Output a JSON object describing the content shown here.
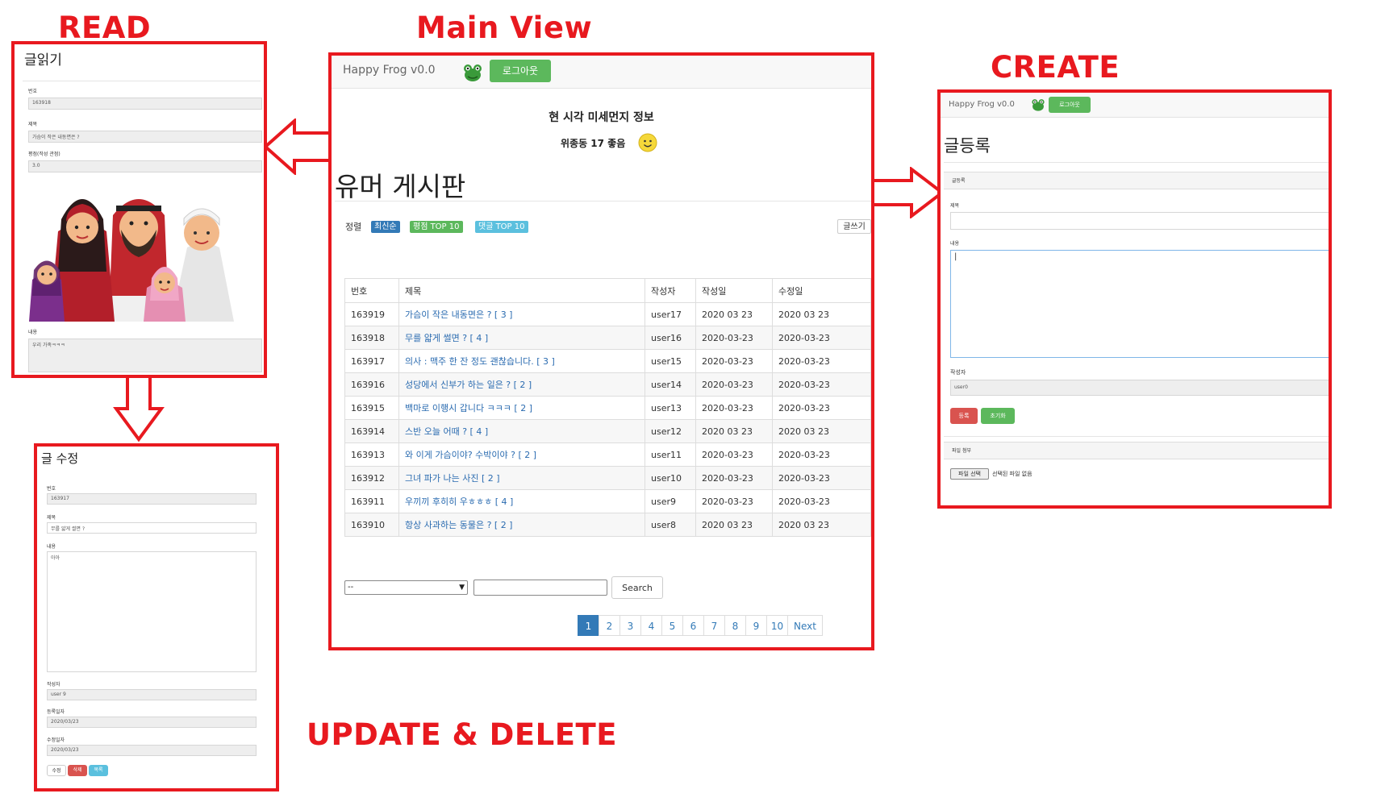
{
  "headings": {
    "read": "READ",
    "main": "Main View",
    "create": "CREATE",
    "update": "UPDATE & DELETE"
  },
  "main": {
    "brand": "Happy Frog v0.0",
    "logout": "로그아웃",
    "dust_title": "현 시각 미세먼지 정보",
    "dust_value": "위종동 17 좋음",
    "board_title": "유머 게시판",
    "sort_label": "정렬",
    "sort_latest": "최신순",
    "sort_rating": "평점 TOP 10",
    "sort_comment": "댓글 TOP 10",
    "write_button": "글쓰기",
    "columns": [
      "번호",
      "제목",
      "작성자",
      "작성일",
      "수정일"
    ],
    "rows": [
      [
        "163919",
        "가슴이 작은 내동면은 ? [ 3 ]",
        "user17",
        "2020 03 23",
        "2020 03 23"
      ],
      [
        "163918",
        "무를 얇게 썰면 ? [ 4 ]",
        "user16",
        "2020-03-23",
        "2020-03-23"
      ],
      [
        "163917",
        "의사 : 맥주 한 잔 정도 괜찮습니다. [ 3 ]",
        "user15",
        "2020-03-23",
        "2020-03-23"
      ],
      [
        "163916",
        "성당에서 신부가 하는 일은 ? [ 2 ]",
        "user14",
        "2020-03-23",
        "2020-03-23"
      ],
      [
        "163915",
        "백마로 이행시 갑니다 ㅋㅋㅋ [ 2 ]",
        "user13",
        "2020-03-23",
        "2020-03-23"
      ],
      [
        "163914",
        "스반 오늘 어때 ? [ 4 ]",
        "user12",
        "2020 03 23",
        "2020 03 23"
      ],
      [
        "163913",
        "와 이게 가슴이야? 수박이야 ? [ 2 ]",
        "user11",
        "2020-03-23",
        "2020-03-23"
      ],
      [
        "163912",
        "그녀 파가 나는 사진 [ 2 ]",
        "user10",
        "2020-03-23",
        "2020-03-23"
      ],
      [
        "163911",
        "우끼끼 후히히 우ㅎㅎㅎ [ 4 ]",
        "user9",
        "2020-03-23",
        "2020-03-23"
      ],
      [
        "163910",
        "항상 사과하는 동물은 ? [ 2 ]",
        "user8",
        "2020 03 23",
        "2020 03 23"
      ]
    ],
    "search_select": "--",
    "search_button": "Search",
    "pages": [
      "1",
      "2",
      "3",
      "4",
      "5",
      "6",
      "7",
      "8",
      "9",
      "10"
    ],
    "next": "Next"
  },
  "read": {
    "title": "글읽기",
    "label_no": "번호",
    "value_no": "163918",
    "label_title": "제목",
    "value_title": "가슴이 작은 내동면은 ?",
    "label_rating": "평점(작성 관점)",
    "value_rating": "3.0",
    "label_content": "내용",
    "value_content": "우리 가족ㅋㅋㅋ"
  },
  "update": {
    "title": "글 수정",
    "label_no": "번호",
    "value_no": "163917",
    "label_title": "제목",
    "value_title": "무를 얇게 썰면 ?",
    "label_content": "내용",
    "value_content": "아아",
    "label_writer": "작성자",
    "value_writer": "user 9",
    "label_reg": "등록일자",
    "value_reg": "2020/03/23",
    "label_mod": "수정일자",
    "value_mod": "2020/03/23",
    "btn_edit": "수정",
    "btn_delete": "삭제",
    "btn_list": "목록"
  },
  "create": {
    "brand": "Happy Frog v0.0",
    "logout": "로그아웃",
    "title": "글등록",
    "panel_head": "글등록",
    "label_title": "제목",
    "label_content": "내용",
    "label_writer": "작성자",
    "value_writer": "user0",
    "btn_submit": "등록",
    "btn_reset": "초기화",
    "file_panel": "파일 첨부",
    "file_button": "파일 선택",
    "file_status": "선택된 파일 없음"
  },
  "colors": {
    "frame": "#e8191f",
    "success": "#5cb85c",
    "primary": "#337ab7",
    "info": "#5bc0de",
    "danger": "#d9534f"
  },
  "icons": [
    "frog-icon",
    "smiley-icon",
    "arrow-left-icon",
    "arrow-right-icon",
    "arrow-down-icon"
  ]
}
